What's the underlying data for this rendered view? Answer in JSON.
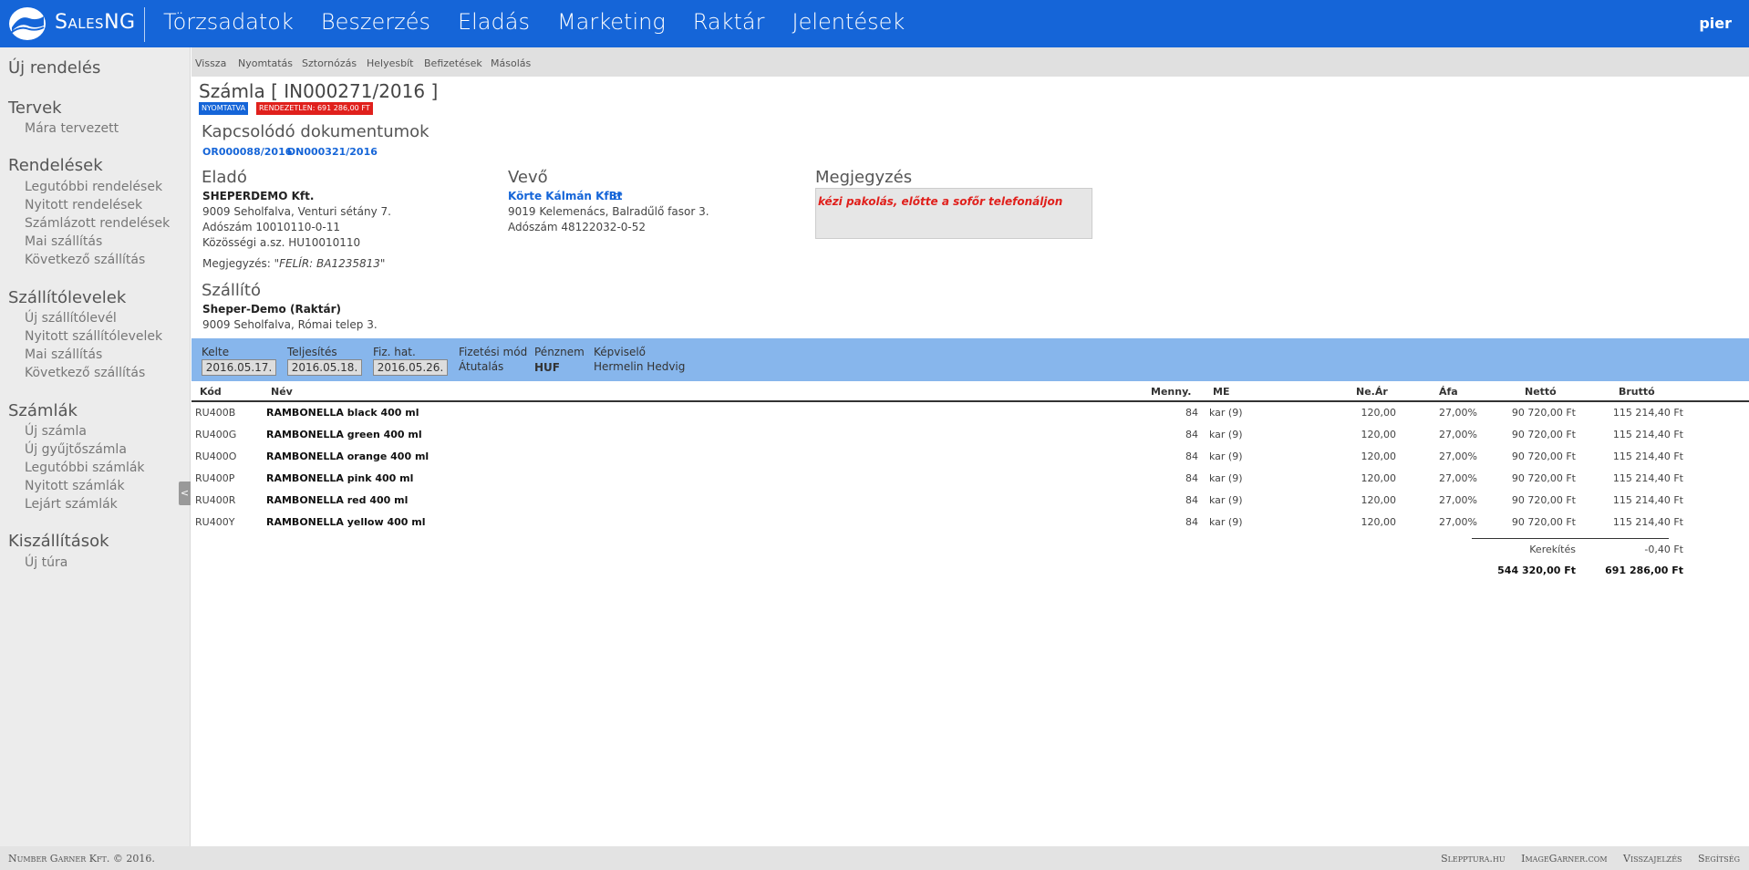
{
  "app": {
    "brand": "SalesNG",
    "user": "pier",
    "nav": [
      "Törzsadatok",
      "Beszerzés",
      "Eladás",
      "Marketing",
      "Raktár",
      "Jelentések"
    ]
  },
  "sidebar": {
    "new_order": "Új rendelés",
    "sections": [
      {
        "title": "Tervek",
        "items": [
          "Mára tervezett"
        ]
      },
      {
        "title": "Rendelések",
        "items": [
          "Legutóbbi rendelések",
          "Nyitott rendelések",
          "Számlázott rendelések",
          "Mai szállítás",
          "Következő szállítás"
        ]
      },
      {
        "title": "Szállítólevelek",
        "items": [
          "Új szállítólevél",
          "Nyitott szállítólevelek",
          "Mai szállítás",
          "Következő szállítás"
        ]
      },
      {
        "title": "Számlák",
        "items": [
          "Új számla",
          "Új gyűjtőszámla",
          "Legutóbbi számlák",
          "Nyitott számlák",
          "Lejárt számlák"
        ]
      },
      {
        "title": "Kiszállítások",
        "items": [
          "Új túra"
        ]
      }
    ],
    "toggle": "<"
  },
  "actions": [
    "Vissza",
    "Nyomtatás",
    "Sztornózás",
    "Helyesbít",
    "Befizetések",
    "Másolás"
  ],
  "invoice": {
    "title": "Számla [ IN000271/2016 ]",
    "badge_printed": "NYOMTATVA",
    "badge_unpaid": "RENDEZETLEN: 691 286,00 FT",
    "related_title": "Kapcsolódó dokumentumok",
    "related": [
      "OR000088/2016",
      "DN000321/2016"
    ],
    "seller": {
      "title": "Eladó",
      "name": "SHEPERDEMO Kft.",
      "address": "9009 Seholfalva, Venturi sétány 7.",
      "tax": "Adószám 10010110-0-11",
      "eu_tax": "Közösségi a.sz. HU10010110",
      "note_label": "Megjegyzés:",
      "note_value": "\"FELÍR: BA1235813\""
    },
    "buyer": {
      "title": "Vevő",
      "name": "Körte Kálmán KfBt",
      "address": "9019 Kelemenács, Balradűlő fasor 3.",
      "tax": "Adószám 48122032-0-52"
    },
    "note": {
      "title": "Megjegyzés",
      "text": "kézi pakolás, előtte a sofőr telefonáljon"
    },
    "carrier": {
      "title": "Szállító",
      "name": "Sheper-Demo (Raktár)",
      "address": "9009 Seholfalva, Római telep 3."
    }
  },
  "infobar": {
    "kelte_label": "Kelte",
    "kelte": "2016.05.17.",
    "teljesites_label": "Teljesítés",
    "teljesites": "2016.05.18.",
    "fiz_label": "Fiz. hat.",
    "fiz": "2016.05.26.",
    "mod_label": "Fizetési mód",
    "mod": "Átutalás",
    "penznem_label": "Pénznem",
    "penznem": "HUF",
    "kepviselo_label": "Képviselő",
    "kepviselo": "Hermelin Hedvig"
  },
  "table": {
    "headers": {
      "kod": "Kód",
      "nev": "Név",
      "menny": "Menny.",
      "me": "ME",
      "near": "Ne.Ár",
      "afa": "Áfa",
      "netto": "Nettó",
      "brutto": "Bruttó"
    },
    "rows": [
      {
        "kod": "RU400B",
        "nev": "RAMBONELLA black 400 ml",
        "menny": "84",
        "me": "kar (9)",
        "near": "120,00",
        "afa": "27,00%",
        "netto": "90 720,00 Ft",
        "brutto": "115 214,40 Ft"
      },
      {
        "kod": "RU400G",
        "nev": "RAMBONELLA green 400 ml",
        "menny": "84",
        "me": "kar (9)",
        "near": "120,00",
        "afa": "27,00%",
        "netto": "90 720,00 Ft",
        "brutto": "115 214,40 Ft"
      },
      {
        "kod": "RU400O",
        "nev": "RAMBONELLA orange 400 ml",
        "menny": "84",
        "me": "kar (9)",
        "near": "120,00",
        "afa": "27,00%",
        "netto": "90 720,00 Ft",
        "brutto": "115 214,40 Ft"
      },
      {
        "kod": "RU400P",
        "nev": "RAMBONELLA pink 400 ml",
        "menny": "84",
        "me": "kar (9)",
        "near": "120,00",
        "afa": "27,00%",
        "netto": "90 720,00 Ft",
        "brutto": "115 214,40 Ft"
      },
      {
        "kod": "RU400R",
        "nev": "RAMBONELLA red 400 ml",
        "menny": "84",
        "me": "kar (9)",
        "near": "120,00",
        "afa": "27,00%",
        "netto": "90 720,00 Ft",
        "brutto": "115 214,40 Ft"
      },
      {
        "kod": "RU400Y",
        "nev": "RAMBONELLA yellow 400 ml",
        "menny": "84",
        "me": "kar (9)",
        "near": "120,00",
        "afa": "27,00%",
        "netto": "90 720,00 Ft",
        "brutto": "115 214,40 Ft"
      }
    ],
    "rounding_label": "Kerekítés",
    "rounding_value": "-0,40 Ft",
    "total_netto": "544 320,00 Ft",
    "total_brutto": "691 286,00 Ft"
  },
  "footer": {
    "copyright": "Number Garner Kft. © 2016.",
    "links": [
      "Slepptura.hu",
      "ImageGarner.com",
      "Visszajelzés",
      "Segítség"
    ]
  },
  "colors": {
    "primary": "#1565d8",
    "danger": "#e0201c",
    "infobar": "#87b6ec"
  }
}
